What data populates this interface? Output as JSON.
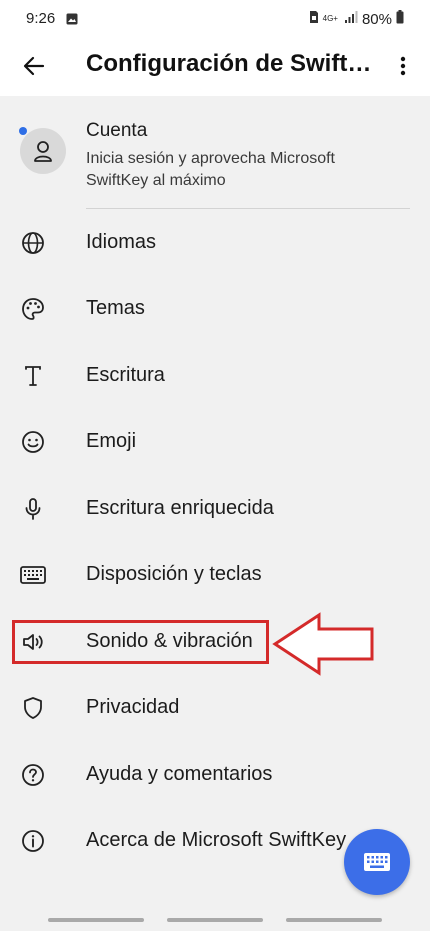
{
  "status": {
    "time": "9:26",
    "network": "4G+",
    "battery": "80%"
  },
  "header": {
    "title": "Configuración de Swift…"
  },
  "account": {
    "title": "Cuenta",
    "subtitle": "Inicia sesión y aprovecha Microsoft SwiftKey al máximo"
  },
  "menu": {
    "items": [
      {
        "label": "Idiomas",
        "icon": "globe-icon"
      },
      {
        "label": "Temas",
        "icon": "palette-icon"
      },
      {
        "label": "Escritura",
        "icon": "text-icon"
      },
      {
        "label": "Emoji",
        "icon": "smiley-icon"
      },
      {
        "label": "Escritura enriquecida",
        "icon": "microphone-icon"
      },
      {
        "label": "Disposición y teclas",
        "icon": "keyboard-icon"
      },
      {
        "label": "Sonido & vibración",
        "icon": "speaker-icon"
      },
      {
        "label": "Privacidad",
        "icon": "shield-icon"
      },
      {
        "label": "Ayuda y comentarios",
        "icon": "help-icon"
      },
      {
        "label": "Acerca de Microsoft SwiftKey",
        "icon": "info-icon"
      }
    ]
  },
  "colors": {
    "accent": "#3c6ee8",
    "highlight": "#d42a2a",
    "background": "#f1f1f1"
  }
}
